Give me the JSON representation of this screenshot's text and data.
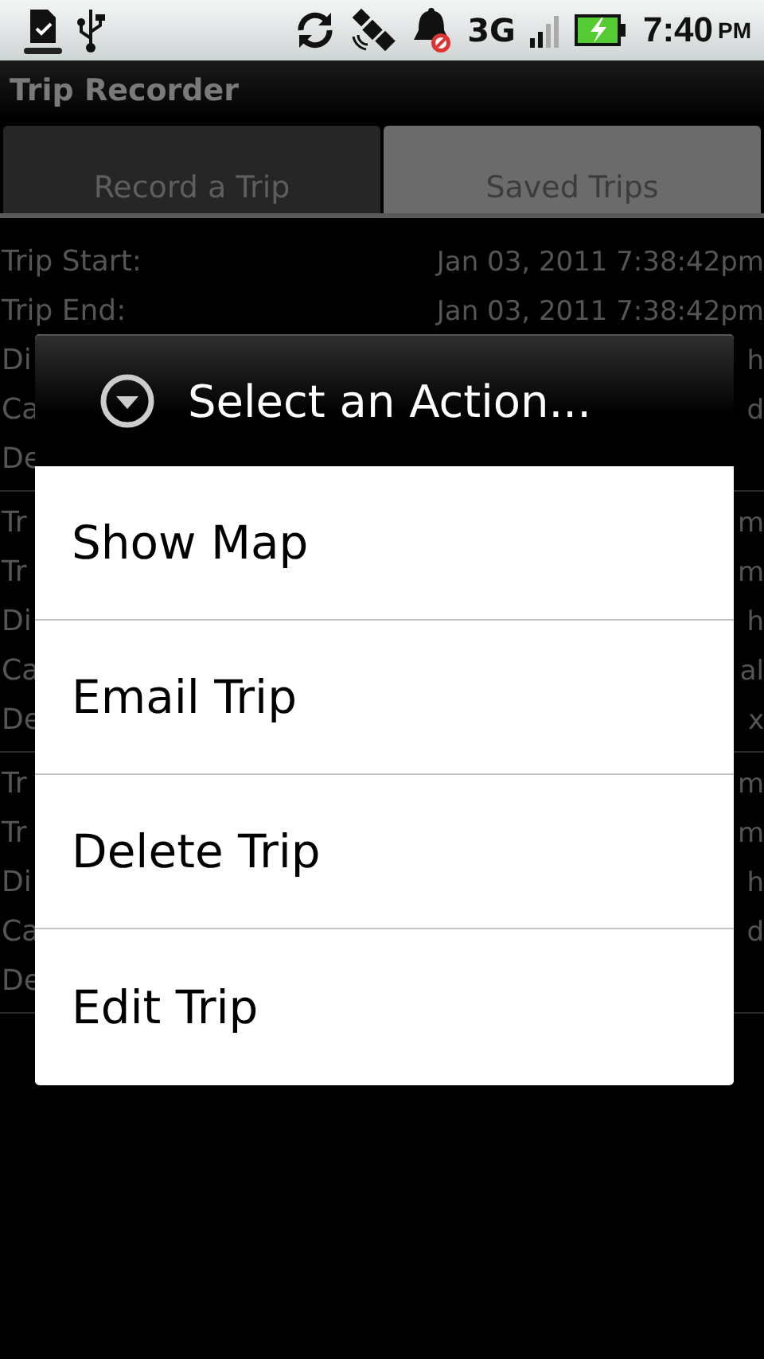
{
  "status_bar": {
    "network": "3G",
    "time": "7:40",
    "ampm": "PM"
  },
  "title_bar": {
    "title": "Trip Recorder"
  },
  "tabs": [
    {
      "label": "Record a Trip",
      "selected": false
    },
    {
      "label": "Saved Trips",
      "selected": true
    }
  ],
  "trips": [
    {
      "rows": [
        {
          "label": "Trip Start:",
          "value": "Jan 03, 2011 7:38:42pm"
        },
        {
          "label": "Trip End:",
          "value": "Jan 03, 2011 7:38:42pm"
        },
        {
          "label": "Di",
          "value": "h"
        },
        {
          "label": "Ca",
          "value": "d"
        },
        {
          "label": "De"
        }
      ]
    },
    {
      "rows": [
        {
          "label": "Tr",
          "value": "m"
        },
        {
          "label": "Tr",
          "value": "m"
        },
        {
          "label": "Di",
          "value": "h"
        },
        {
          "label": "Ca",
          "value": "al"
        },
        {
          "label": "De",
          "value": "x"
        }
      ]
    },
    {
      "rows": [
        {
          "label": "Tr",
          "value": "m"
        },
        {
          "label": "Tr",
          "value": "m"
        },
        {
          "label": "Di",
          "value": "h"
        },
        {
          "label": "Ca",
          "value": "d"
        },
        {
          "label": "De"
        }
      ]
    }
  ],
  "dialog": {
    "title": "Select an Action...",
    "items": [
      "Show Map",
      "Email Trip",
      "Delete Trip",
      "Edit Trip"
    ]
  }
}
